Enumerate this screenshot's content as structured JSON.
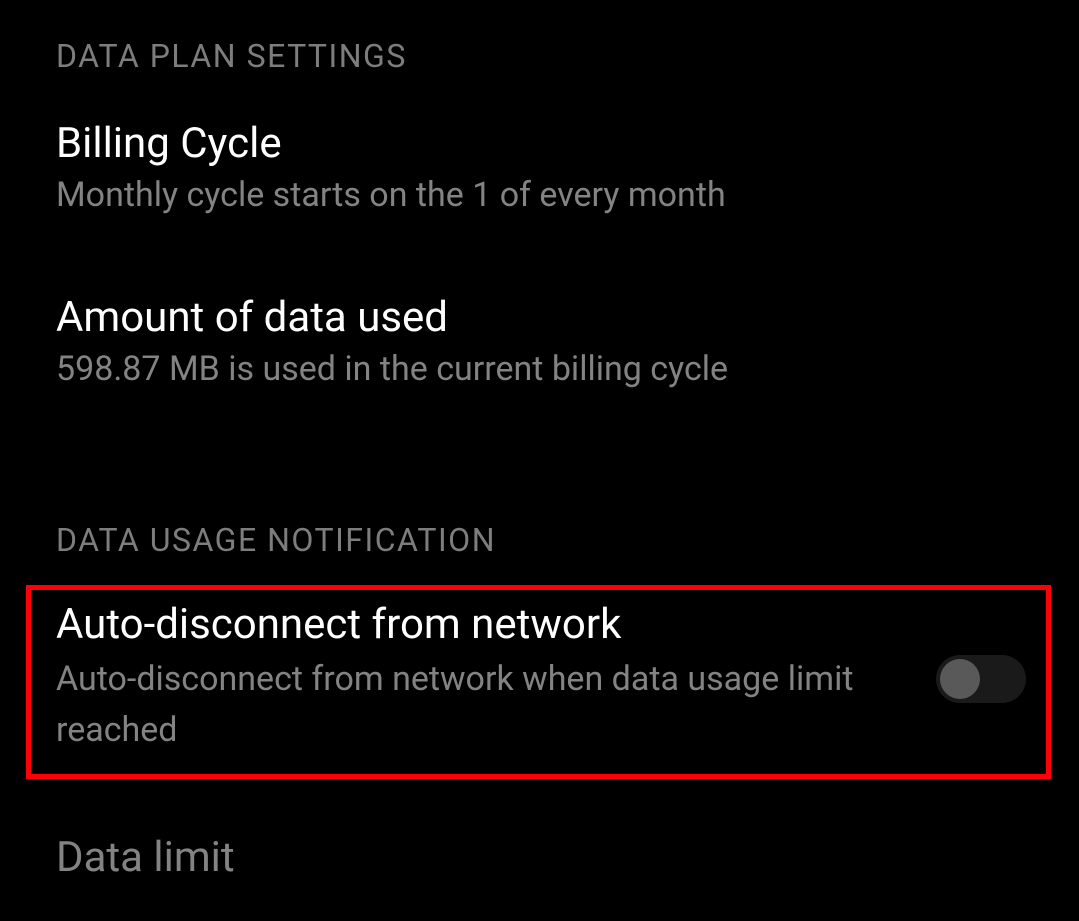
{
  "sections": {
    "dataPlan": {
      "header": "DATA PLAN SETTINGS",
      "billingCycle": {
        "title": "Billing Cycle",
        "subtitle": "Monthly cycle starts on the 1 of every month"
      },
      "amountUsed": {
        "title": "Amount of data used",
        "subtitle": " 598.87 MB is used in the current billing cycle"
      }
    },
    "dataUsageNotification": {
      "header": "DATA USAGE NOTIFICATION",
      "autoDisconnect": {
        "title": "Auto-disconnect from network",
        "subtitle": "Auto-disconnect from network when data usage limit reached",
        "toggle": false
      },
      "dataLimit": {
        "title": "Data limit"
      }
    }
  }
}
